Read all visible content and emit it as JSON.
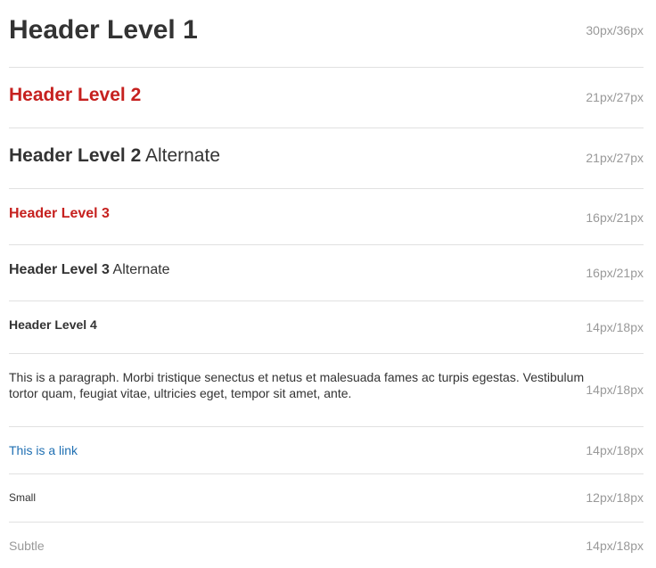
{
  "colors": {
    "text": "#333333",
    "heading_accent": "#c6211f",
    "link": "#1f6fb2",
    "subtle": "#999999",
    "rule": "#e1e1e1"
  },
  "rows": [
    {
      "sample": "Header Level 1",
      "spec": "30px/36px"
    },
    {
      "sample": "Header Level 2",
      "spec": "21px/27px"
    },
    {
      "sample_bold": "Header Level 2",
      "sample_light": "Alternate",
      "spec": "21px/27px"
    },
    {
      "sample": "Header Level 3",
      "spec": "16px/21px"
    },
    {
      "sample_bold": "Header Level 3",
      "sample_light": "Alternate",
      "spec": "16px/21px"
    },
    {
      "sample": "Header Level 4",
      "spec": "14px/18px"
    },
    {
      "sample": "This is a paragraph. Morbi tristique senectus et netus et malesuada fames ac turpis egestas. Vestibulum tortor quam, feugiat vitae, ultricies eget, tempor sit amet, ante.",
      "spec": "14px/18px"
    },
    {
      "sample": "This is a link",
      "spec": "14px/18px"
    },
    {
      "sample": "Small",
      "spec": "12px/18px"
    },
    {
      "sample": "Subtle",
      "spec": "14px/18px"
    }
  ]
}
